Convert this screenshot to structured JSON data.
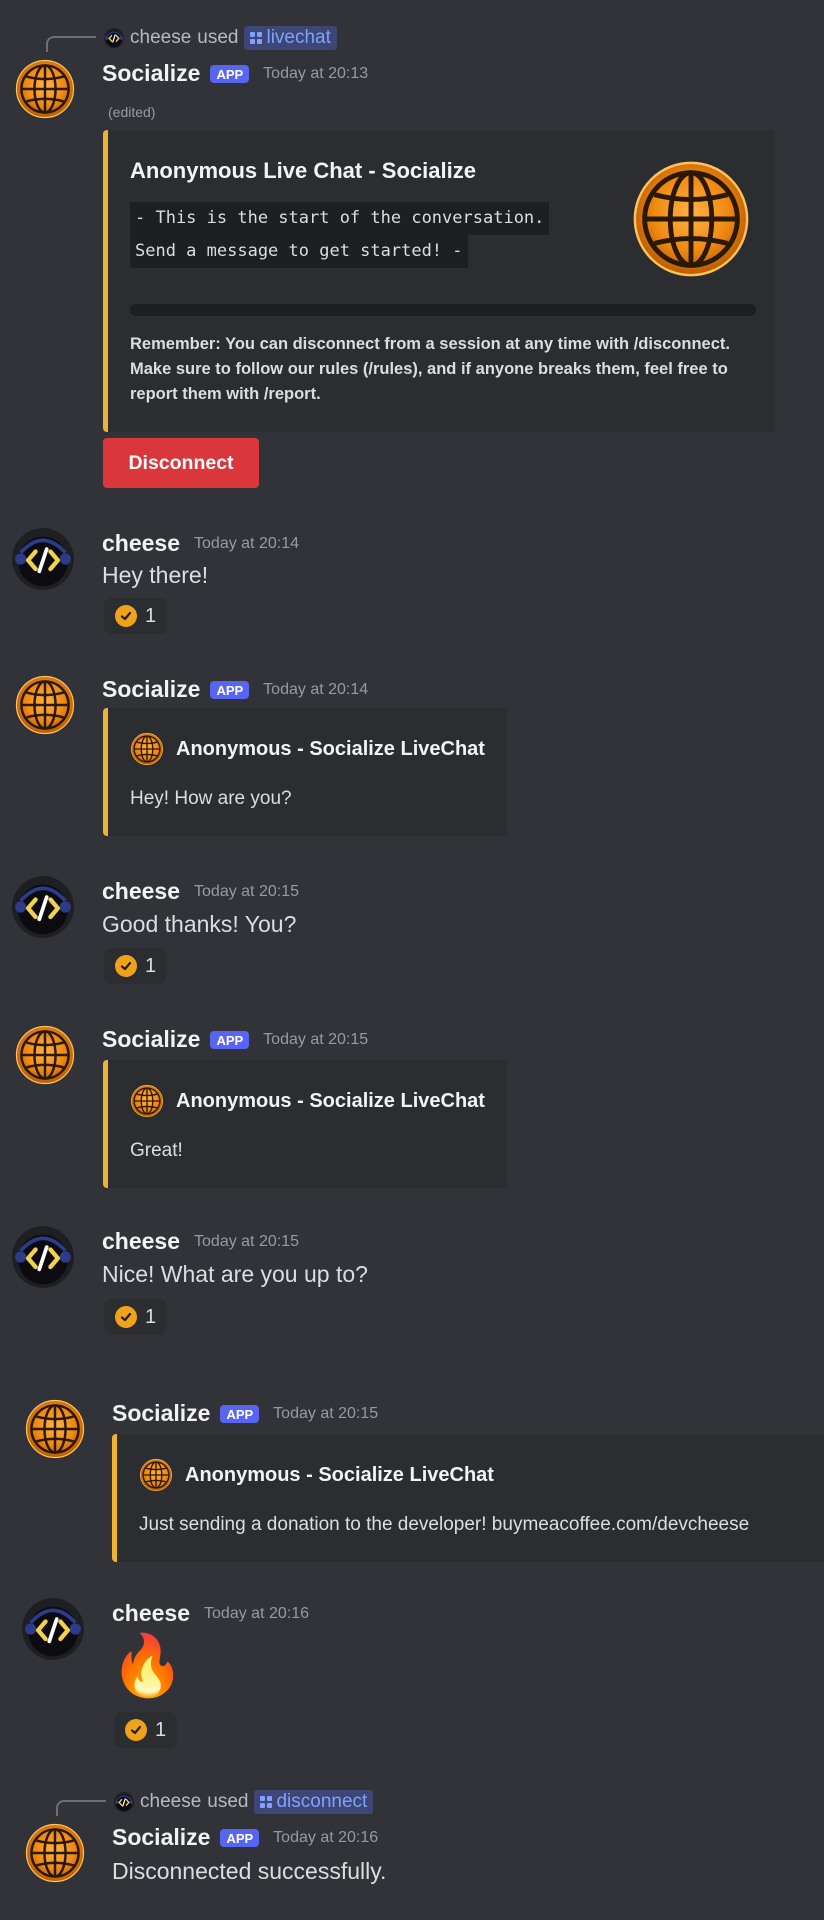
{
  "colors": {
    "background": "#313338",
    "embed_accent": "#f0b232",
    "app_badge": "#5865f2",
    "danger_button": "#da373c",
    "command_link": "#7ea2ff"
  },
  "app_badge": "APP",
  "messages": [
    {
      "id": "m1",
      "author": "Socialize",
      "timestamp": "Today at 20:13",
      "edited": "(edited)",
      "reply": {
        "user": "cheese",
        "used": "used",
        "command": "livechat"
      },
      "embed": {
        "title": "Anonymous Live Chat - Socialize",
        "code_line_1": "- This is the start of the conversation.",
        "code_line_2": "Send a message to get started! -",
        "footer_text": "Remember: You can disconnect from a session at any time with /disconnect. Make sure to follow our rules (/rules), and if anyone breaks them, feel free to report them with /report."
      },
      "button": "Disconnect"
    },
    {
      "id": "m2",
      "author": "cheese",
      "timestamp": "Today at 20:14",
      "text": "Hey there!",
      "reaction_count": "1"
    },
    {
      "id": "m3",
      "author": "Socialize",
      "timestamp": "Today at 20:14",
      "embed": {
        "author": "Anonymous - Socialize LiveChat",
        "description": "Hey! How are you?"
      }
    },
    {
      "id": "m4",
      "author": "cheese",
      "timestamp": "Today at 20:15",
      "text": "Good thanks! You?",
      "reaction_count": "1"
    },
    {
      "id": "m5",
      "author": "Socialize",
      "timestamp": "Today at 20:15",
      "embed": {
        "author": "Anonymous - Socialize LiveChat",
        "description": "Great!"
      }
    },
    {
      "id": "m6",
      "author": "cheese",
      "timestamp": "Today at 20:15",
      "text": "Nice! What are you up to?",
      "reaction_count": "1"
    },
    {
      "id": "m7",
      "author": "Socialize",
      "timestamp": "Today at 20:15",
      "embed": {
        "author": "Anonymous - Socialize LiveChat",
        "description": "Just sending a donation to the developer! buymeacoffee.com/devcheese"
      }
    },
    {
      "id": "m8",
      "author": "cheese",
      "timestamp": "Today at 20:16",
      "emoji": "🔥",
      "emoji_icon": "fire-emoji",
      "reaction_count": "1"
    },
    {
      "id": "m9",
      "author": "Socialize",
      "timestamp": "Today at 20:16",
      "reply": {
        "user": "cheese",
        "used": "used",
        "command": "disconnect"
      },
      "text": "Disconnected successfully."
    }
  ],
  "icons": {
    "globe": "globe-avatar-icon",
    "code": "code-avatar-icon",
    "reaction": "checkmark-reaction-icon",
    "slash_command": "slash-command-icon"
  }
}
